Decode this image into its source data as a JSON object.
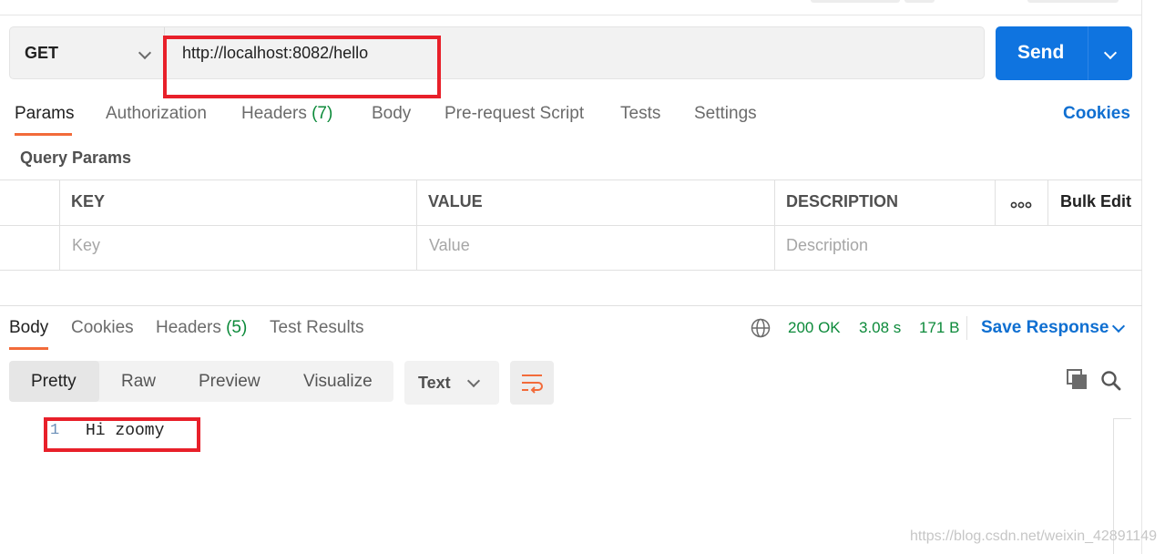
{
  "request": {
    "method": "GET",
    "url": "http://localhost:8082/hello",
    "send_label": "Send"
  },
  "request_tabs": [
    {
      "label": "Params"
    },
    {
      "label": "Authorization"
    },
    {
      "label": "Headers",
      "count": "(7)"
    },
    {
      "label": "Body"
    },
    {
      "label": "Pre-request Script"
    },
    {
      "label": "Tests"
    },
    {
      "label": "Settings"
    }
  ],
  "cookies_link": "Cookies",
  "query_params": {
    "title": "Query Params",
    "columns": [
      "KEY",
      "VALUE",
      "DESCRIPTION"
    ],
    "bulk_edit": "Bulk Edit",
    "placeholders": [
      "Key",
      "Value",
      "Description"
    ]
  },
  "response": {
    "tabs": [
      {
        "label": "Body"
      },
      {
        "label": "Cookies"
      },
      {
        "label": "Headers",
        "count": "(5)"
      },
      {
        "label": "Test Results"
      }
    ],
    "status": "200 OK",
    "time": "3.08 s",
    "size": "171 B",
    "save_label": "Save Response",
    "view_modes": [
      "Pretty",
      "Raw",
      "Preview",
      "Visualize"
    ],
    "format": "Text",
    "line_number": "1",
    "body_line": "Hi zoomy"
  },
  "watermark": "https://blog.csdn.net/weixin_42891149",
  "colors": {
    "accent": "#0f74e0",
    "status_green": "#0c8a3a",
    "tab_underline": "#f26b3a",
    "annotation_red": "#e8202a"
  }
}
